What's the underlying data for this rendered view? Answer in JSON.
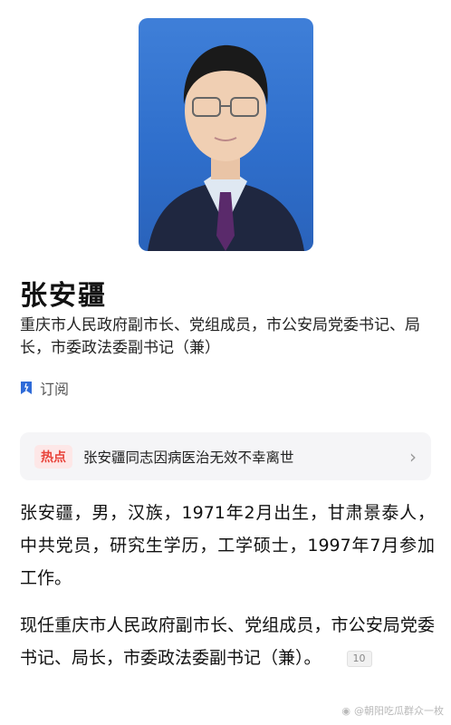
{
  "profile": {
    "name": "张安疆",
    "title": "重庆市人民政府副市长、党组成员，市公安局党委书记、局长，市委政法委副书记（兼）",
    "subscribe_label": "订阅"
  },
  "hot": {
    "badge": "热点",
    "text": "张安疆同志因病医治无效不幸离世"
  },
  "bio": {
    "paragraph1": "张安疆，男，汉族，1971年2月出生，甘肃景泰人，中共党员，研究生学历，工学硕士，1997年7月参加工作。",
    "paragraph2": "现任重庆市人民政府副市长、党组成员，市公安局党委书记、局长，市委政法委副书记（兼）。",
    "ref": "10"
  },
  "watermark": "@朝阳吃瓜群众一枚",
  "colors": {
    "hot_badge": "#e8433a",
    "subscribe_icon": "#2f6bd8",
    "photo_bg": "#3f7fd8"
  }
}
